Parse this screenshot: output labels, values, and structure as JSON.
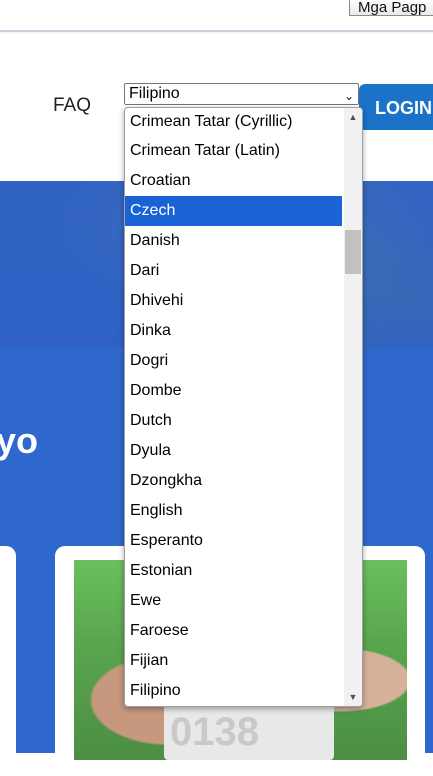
{
  "topbar": {
    "language_label": "Mga Pagp"
  },
  "header": {
    "faq_label": "FAQ",
    "login_label": "LOGIN"
  },
  "hero": {
    "heading_fragment": "yo"
  },
  "card": {
    "bib_number": "0138"
  },
  "language_select": {
    "selected": "Filipino",
    "highlighted": "Czech",
    "options": [
      "Crimean Tatar (Cyrillic)",
      "Crimean Tatar (Latin)",
      "Croatian",
      "Czech",
      "Danish",
      "Dari",
      "Dhivehi",
      "Dinka",
      "Dogri",
      "Dombe",
      "Dutch",
      "Dyula",
      "Dzongkha",
      "English",
      "Esperanto",
      "Estonian",
      "Ewe",
      "Faroese",
      "Fijian",
      "Filipino"
    ]
  },
  "colors": {
    "highlight": "#1a63d6",
    "login_button": "#1a73c9",
    "hero_blue": "#2f68cc"
  },
  "icons": {
    "select_arrow": "chevron-down-icon",
    "scroll_up": "triangle-up-icon",
    "scroll_down": "triangle-down-icon"
  }
}
